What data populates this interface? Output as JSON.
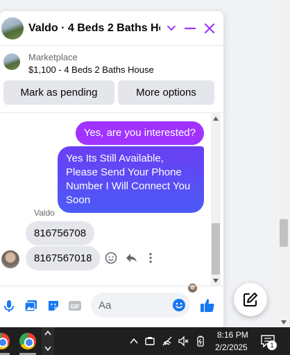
{
  "header": {
    "title": "Valdo · 4 Beds 2 Baths Ho..."
  },
  "listing": {
    "source": "Marketplace",
    "price_title": "$1,100 - 4 Beds 2 Baths House",
    "pending_label": "Mark as pending",
    "more_label": "More options"
  },
  "messages": {
    "sent": [
      "Yes, are you interested?",
      "Yes Its Still Available, Please Send Your Phone Number I Will Connect You Soon"
    ],
    "sender_name": "Valdo",
    "received": [
      "816756708",
      "8167567018"
    ]
  },
  "composer": {
    "placeholder": "Aa"
  },
  "taskbar": {
    "time": "8:16 PM",
    "date": "2/2/2025",
    "notification_count": "1"
  },
  "colors": {
    "accent": "#a033ff",
    "outgoing_gradient_start": "#6a3ff4",
    "outgoing_gradient_end": "#4b5af6",
    "icon_blue": "#1877f2"
  },
  "icons": [
    "chevron-down-icon",
    "minimize-icon",
    "close-icon",
    "microphone-icon",
    "photo-icon",
    "sticker-icon",
    "gif-icon",
    "emoji-icon",
    "thumbs-up-icon",
    "react-icon",
    "reply-icon",
    "more-icon",
    "compose-icon",
    "notification-icon"
  ]
}
